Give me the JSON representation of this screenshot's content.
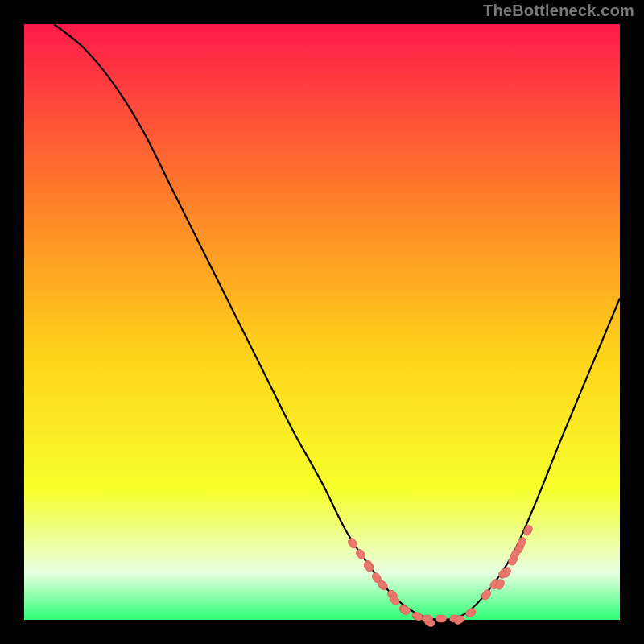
{
  "watermark": "TheBottleneck.com",
  "colors": {
    "frame": "#000000",
    "curve": "#000000",
    "marker_fill": "#e8776d",
    "marker_stroke": "#d7594e",
    "gradient_top": "#ff1a4a",
    "gradient_mid1": "#ff7a2a",
    "gradient_mid2": "#ffd21a",
    "gradient_mid3": "#f7ff2a",
    "gradient_bottom_band": "#e8ffe0",
    "gradient_green": "#2fff77"
  },
  "chart_data": {
    "type": "line",
    "title": "",
    "xlabel": "",
    "ylabel": "",
    "xlim": [
      0,
      100
    ],
    "ylim": [
      0,
      100
    ],
    "grid": false,
    "legend": "none",
    "series": [
      {
        "name": "bottleneck-curve",
        "x": [
          5,
          10,
          15,
          20,
          25,
          30,
          35,
          40,
          45,
          50,
          54,
          58,
          62,
          66,
          70,
          74,
          78,
          82,
          86,
          90,
          95,
          100
        ],
        "values": [
          100,
          96,
          90,
          82,
          72,
          62,
          52,
          42,
          32,
          23,
          15,
          9,
          4,
          1,
          0,
          1,
          5,
          11,
          20,
          30,
          42,
          54
        ]
      }
    ],
    "markers": {
      "name": "highlight-dots",
      "style": "pill",
      "groups": [
        {
          "center_x": 56.5,
          "y": 11,
          "count": 3,
          "spread": 3
        },
        {
          "center_x": 58.5,
          "y": 8,
          "count": 2,
          "spread": 2
        },
        {
          "center_x": 61,
          "y": 5,
          "count": 2,
          "spread": 2
        },
        {
          "center_x": 63,
          "y": 2.5,
          "count": 2,
          "spread": 2
        },
        {
          "center_x": 66,
          "y": 0.6,
          "count": 3,
          "spread": 3
        },
        {
          "center_x": 70,
          "y": 0.2,
          "count": 3,
          "spread": 3
        },
        {
          "center_x": 74,
          "y": 0.6,
          "count": 2,
          "spread": 2
        },
        {
          "center_x": 79,
          "y": 6,
          "count": 3,
          "spread": 3
        },
        {
          "center_x": 81.5,
          "y": 9,
          "count": 4,
          "spread": 3
        },
        {
          "center_x": 83.5,
          "y": 13,
          "count": 3,
          "spread": 3
        }
      ]
    }
  }
}
